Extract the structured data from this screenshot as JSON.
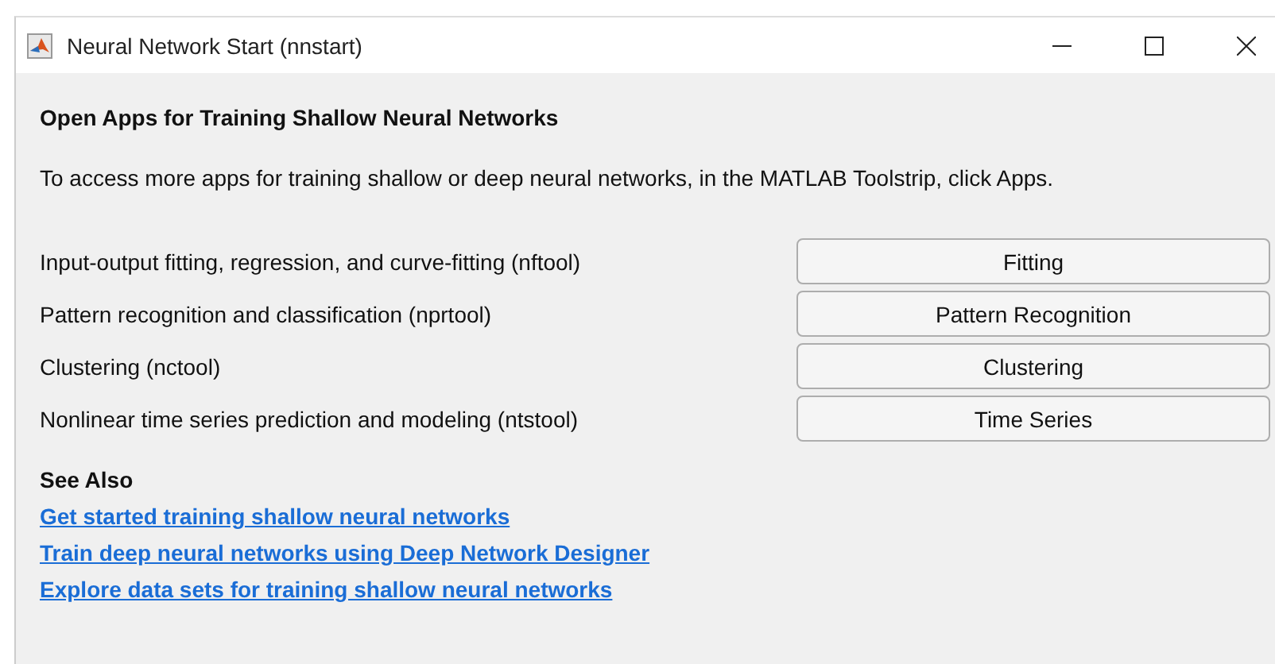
{
  "window": {
    "title": "Neural Network Start (nnstart)"
  },
  "heading": "Open Apps for Training Shallow Neural Networks",
  "intro": "To access more apps for training shallow or deep neural networks, in the MATLAB Toolstrip, click Apps.",
  "apps": [
    {
      "description": "Input-output fitting, regression, and curve-fitting (nftool)",
      "button": "Fitting"
    },
    {
      "description": "Pattern recognition and classification (nprtool)",
      "button": "Pattern Recognition"
    },
    {
      "description": "Clustering (nctool)",
      "button": "Clustering"
    },
    {
      "description": "Nonlinear time series prediction and modeling (ntstool)",
      "button": "Time Series"
    }
  ],
  "see_also": {
    "heading": "See Also",
    "links": [
      "Get started training shallow neural networks",
      "Train deep neural networks using Deep Network Designer",
      "Explore data sets for training shallow neural networks"
    ]
  }
}
